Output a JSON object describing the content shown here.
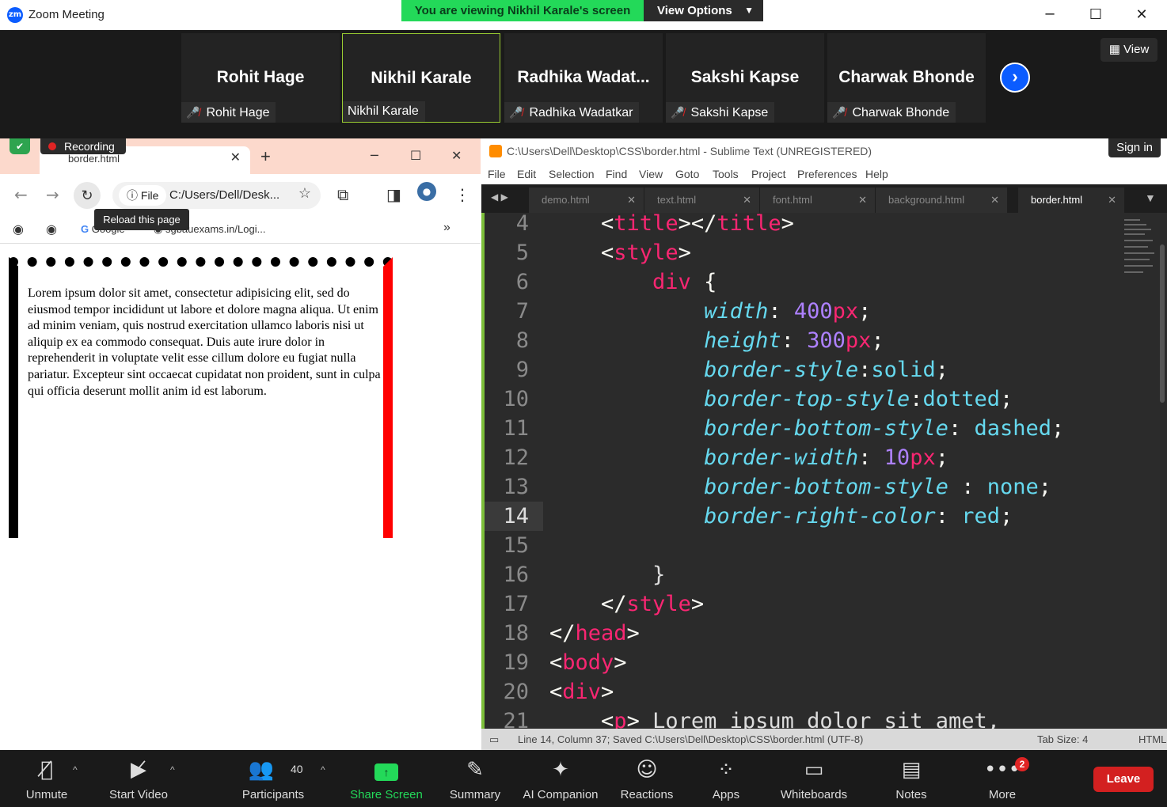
{
  "window": {
    "title": "Zoom Meeting",
    "logo_text": "zm",
    "banner": "You are viewing Nikhil Karale's screen",
    "view_options": "View Options"
  },
  "gallery": {
    "view_label": "View",
    "participants": [
      {
        "display": "Rohit Hage",
        "footer": "Rohit Hage",
        "muted": true
      },
      {
        "display": "Nikhil Karale",
        "footer": "Nikhil Karale",
        "muted": false
      },
      {
        "display": "Radhika  Wadat...",
        "footer": "Radhika Wadatkar",
        "muted": true
      },
      {
        "display": "Sakshi Kapse",
        "footer": "Sakshi Kapse",
        "muted": true
      },
      {
        "display": "Charwak Bhonde",
        "footer": "Charwak Bhonde",
        "muted": true
      }
    ]
  },
  "browser": {
    "recording": "Recording",
    "tab_title": "border.html",
    "address_chip": "File",
    "address": "C:/Users/Dell/Desk...",
    "tooltip": "Reload this page",
    "bookmarks": [
      "Google",
      "sgbauexams.in/Logi..."
    ],
    "page_text": "Lorem ipsum dolor sit amet, consectetur adipisicing elit, sed do eiusmod tempor incididunt ut labore et dolore magna aliqua. Ut enim ad minim veniam, quis nostrud exercitation ullamco laboris nisi ut aliquip ex ea commodo consequat. Duis aute irure dolor in reprehenderit in voluptate velit esse cillum dolore eu fugiat nulla pariatur. Excepteur sint occaecat cupidatat non proident, sunt in culpa qui officia deserunt mollit anim id est laborum."
  },
  "editor": {
    "title": "C:\\Users\\Dell\\Desktop\\CSS\\border.html - Sublime Text (UNREGISTERED)",
    "sign_in": "Sign in",
    "menu": [
      "File",
      "Edit",
      "Selection",
      "Find",
      "View",
      "Goto",
      "Tools",
      "Project",
      "Preferences",
      "Help"
    ],
    "tabs": [
      "demo.html",
      "text.html",
      "font.html",
      "background.html",
      "border.html"
    ],
    "active_tab": "border.html",
    "current_line": 14,
    "status_left": "Line 14, Column 37; Saved C:\\Users\\Dell\\Desktop\\CSS\\border.html (UTF-8)",
    "status_tab": "Tab Size: 4",
    "status_syntax": "HTML",
    "lines": [
      {
        "n": "4",
        "code": "    <title></title>"
      },
      {
        "n": "5",
        "code": "    <style>"
      },
      {
        "n": "6",
        "code": "        div {"
      },
      {
        "n": "7",
        "code": "            width: 400px;"
      },
      {
        "n": "8",
        "code": "            height: 300px;"
      },
      {
        "n": "9",
        "code": "            border-style:solid;"
      },
      {
        "n": "10",
        "code": "            border-top-style:dotted;"
      },
      {
        "n": "11",
        "code": "            border-bottom-style: dashed;"
      },
      {
        "n": "12",
        "code": "            border-width: 10px;"
      },
      {
        "n": "13",
        "code": "            border-bottom-style : none;"
      },
      {
        "n": "14",
        "code": "            border-right-color: red;"
      },
      {
        "n": "15",
        "code": ""
      },
      {
        "n": "16",
        "code": "        }"
      },
      {
        "n": "17",
        "code": "    </style>"
      },
      {
        "n": "18",
        "code": "</head>"
      },
      {
        "n": "19",
        "code": "<body>"
      },
      {
        "n": "20",
        "code": "<div>"
      },
      {
        "n": "21",
        "code": "    <p> Lorem ipsum dolor sit amet,"
      }
    ]
  },
  "toolbar": {
    "unmute": "Unmute",
    "start_video": "Start Video",
    "participants": "Participants",
    "participants_count": "40",
    "share_screen": "Share Screen",
    "summary": "Summary",
    "ai_companion": "AI Companion",
    "reactions": "Reactions",
    "apps": "Apps",
    "whiteboards": "Whiteboards",
    "notes": "Notes",
    "more": "More",
    "more_badge": "2",
    "leave": "Leave"
  },
  "colors": {
    "zoom_blue": "#0b5cff",
    "banner_green": "#23d959",
    "leave_red": "#d32020",
    "muted_red": "#e02424",
    "sublime_tag": "#f92672",
    "sublime_prop": "#66d9ef",
    "sublime_num": "#ae81ff"
  }
}
